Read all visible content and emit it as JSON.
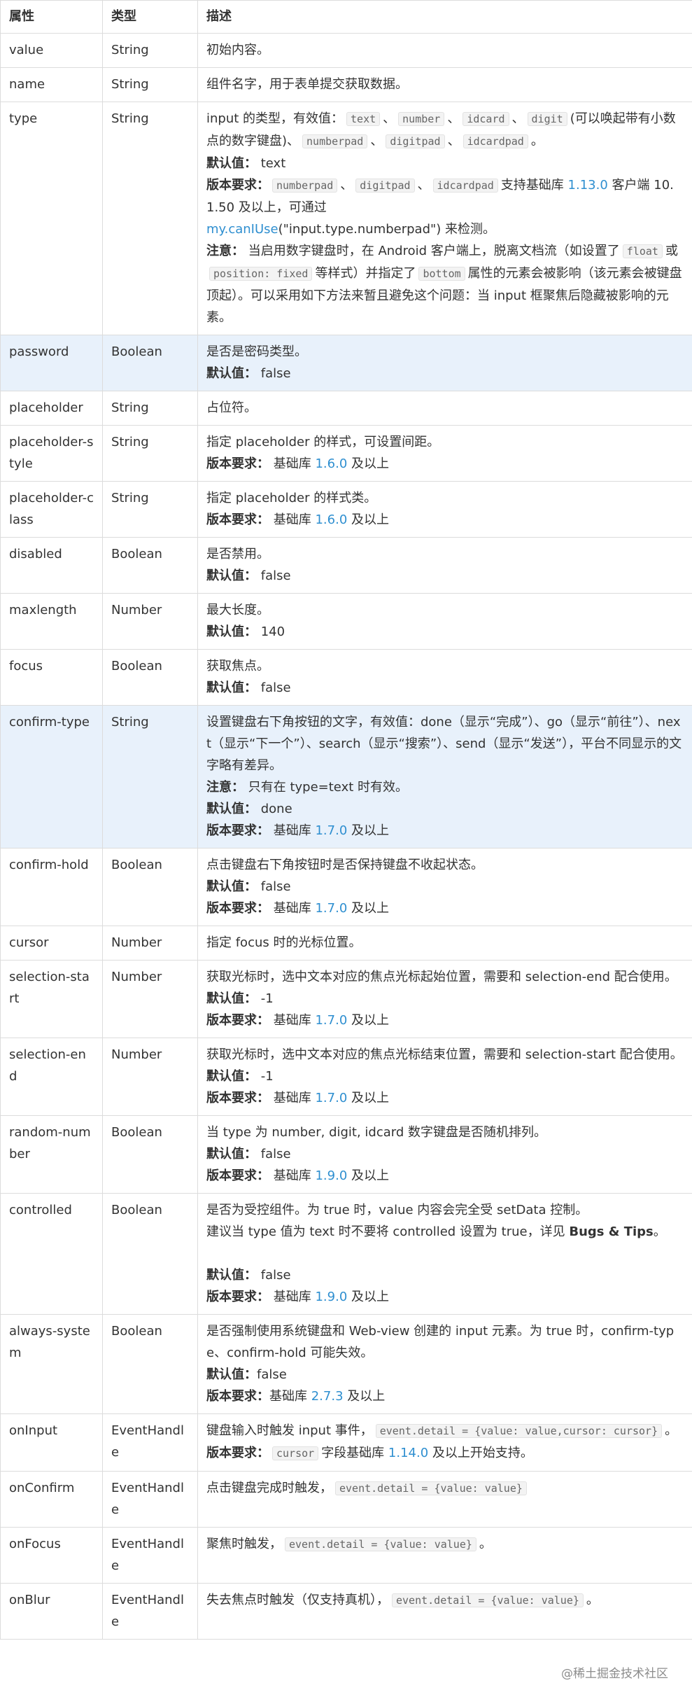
{
  "header": {
    "attr": "属性",
    "type": "类型",
    "desc": "描述"
  },
  "rows": {
    "value": {
      "name": "value",
      "type": "String",
      "desc": "初始内容。"
    },
    "name": {
      "name": "name",
      "type": "String",
      "desc": "组件名字，用于表单提交获取数据。"
    },
    "type_row": {
      "name": "type",
      "type": "String",
      "d1": "input 的类型，有效值：",
      "c_text": "text",
      "sep": "、",
      "c_number": "number",
      "c_idcard": "idcard",
      "c_digit": "digit",
      "d2": "(可以唤起带有小数点的数字键盘)、",
      "c_numberpad": "numberpad",
      "c_digitpad": "digitpad",
      "c_idcardpad": "idcardpad",
      "d3": "。",
      "default_label": "默认值：",
      "default_value": "text",
      "version_label": "版本要求：",
      "d4": "支持基础库",
      "v_lib": "1.13.0",
      "d5": "客户端 10.1.50 及以上，可通过",
      "link_canIUse": "my.canIUse",
      "d6": "(\"input.type.numberpad\") 来检测。",
      "note_label": "注意：",
      "n1": "当启用数字键盘时，在 Android 客户端上，脱离文档流（如设置了",
      "c_float": "float",
      "n2": "或",
      "c_position": "position: fixed",
      "n3": "等样式）并指定了",
      "c_bottom": "bottom",
      "n4": "属性的元素会被影响（该元素会被键盘顶起）。可以采用如下方法来暂且避免这个问题：当 input 框聚焦后隐藏被影响的元素。"
    },
    "password": {
      "name": "password",
      "type": "Boolean",
      "desc": "是否是密码类型。",
      "default_label": "默认值：",
      "default_value": "false"
    },
    "placeholder": {
      "name": "placeholder",
      "type": "String",
      "desc": "占位符。"
    },
    "placeholder_style": {
      "name": "placeholder-style",
      "type": "String",
      "desc": "指定 placeholder 的样式，可设置间距。",
      "version_label": "版本要求：",
      "v_prefix": "基础库",
      "v_num": "1.6.0",
      "v_suffix": "及以上"
    },
    "placeholder_class": {
      "name": "placeholder-class",
      "type": "String",
      "desc": "指定 placeholder 的样式类。",
      "version_label": "版本要求：",
      "v_prefix": "基础库",
      "v_num": "1.6.0",
      "v_suffix": "及以上"
    },
    "disabled": {
      "name": "disabled",
      "type": "Boolean",
      "desc": "是否禁用。",
      "default_label": "默认值：",
      "default_value": "false"
    },
    "maxlength": {
      "name": "maxlength",
      "type": "Number",
      "desc": "最大长度。",
      "default_label": "默认值：",
      "default_value": "140"
    },
    "focus": {
      "name": "focus",
      "type": "Boolean",
      "desc": "获取焦点。",
      "default_label": "默认值：",
      "default_value": "false"
    },
    "confirm_type": {
      "name": "confirm-type",
      "type": "String",
      "desc": "设置键盘右下角按钮的文字，有效值：done（显示“完成”）、go（显示“前往”）、next（显示“下一个”）、search（显示“搜索”）、send（显示“发送”），平台不同显示的文字略有差异。",
      "note_label": "注意：",
      "note": "只有在 type=text 时有效。",
      "default_label": "默认值：",
      "default_value": "done",
      "version_label": "版本要求：",
      "v_prefix": "基础库",
      "v_num": "1.7.0",
      "v_suffix": "及以上"
    },
    "confirm_hold": {
      "name": "confirm-hold",
      "type": "Boolean",
      "desc": "点击键盘右下角按钮时是否保持键盘不收起状态。",
      "default_label": "默认值：",
      "default_value": "false",
      "version_label": "版本要求：",
      "v_prefix": "基础库",
      "v_num": "1.7.0",
      "v_suffix": "及以上"
    },
    "cursor": {
      "name": "cursor",
      "type": "Number",
      "desc": "指定 focus 时的光标位置。"
    },
    "selection_start": {
      "name": "selection-start",
      "type": "Number",
      "desc": "获取光标时，选中文本对应的焦点光标起始位置，需要和 selection-end 配合使用。",
      "default_label": "默认值：",
      "default_value": "-1",
      "version_label": "版本要求：",
      "v_prefix": "基础库",
      "v_num": "1.7.0",
      "v_suffix": "及以上"
    },
    "selection_end": {
      "name": "selection-end",
      "type": "Number",
      "desc": "获取光标时，选中文本对应的焦点光标结束位置，需要和 selection-start 配合使用。",
      "default_label": "默认值：",
      "default_value": "-1",
      "version_label": "版本要求：",
      "v_prefix": "基础库",
      "v_num": "1.7.0",
      "v_suffix": "及以上"
    },
    "random_number": {
      "name": "random-number",
      "type": "Boolean",
      "desc": "当 type 为 number, digit, idcard 数字键盘是否随机排列。",
      "default_label": "默认值：",
      "default_value": "false",
      "version_label": "版本要求：",
      "v_prefix": "基础库",
      "v_num": "1.9.0",
      "v_suffix": "及以上"
    },
    "controlled": {
      "name": "controlled",
      "type": "Boolean",
      "desc": "是否为受控组件。为 true 时，value 内容会完全受 setData 控制。",
      "desc2": "建议当 type 值为 text 时不要将 controlled 设置为 true，详见",
      "bold_link": "Bugs & Tips",
      "desc2_end": "。",
      "default_label": "默认值：",
      "default_value": "false",
      "version_label": "版本要求：",
      "v_prefix": "基础库",
      "v_num": "1.9.0",
      "v_suffix": "及以上"
    },
    "always_system": {
      "name": "always-system",
      "type": "Boolean",
      "desc": "是否强制使用系统键盘和 Web-view 创建的 input 元素。为 true 时，confirm-type、confirm-hold 可能失效。",
      "default_label": "默认值：",
      "default_value": "false",
      "version_label": "版本要求：",
      "v_prefix": "基础库",
      "v_num": "2.7.3",
      "v_suffix": "及以上"
    },
    "onInput": {
      "name": "onInput",
      "type": "EventHandle",
      "desc": "键盘输入时触发 input 事件，",
      "code": "event.detail = {value: value,cursor: cursor}",
      "desc_end": "。",
      "version_label": "版本要求：",
      "c_cursor": "cursor",
      "v_mid": "字段基础库",
      "v_num": "1.14.0",
      "v_suffix": "及以上开始支持。"
    },
    "onConfirm": {
      "name": "onConfirm",
      "type": "EventHandle",
      "desc": "点击键盘完成时触发，",
      "code": "event.detail = {value: value}"
    },
    "onFocus": {
      "name": "onFocus",
      "type": "EventHandle",
      "desc": "聚焦时触发，",
      "code": "event.detail = {value: value}",
      "desc_end": "。"
    },
    "onBlur": {
      "name": "onBlur",
      "type": "EventHandle",
      "desc": "失去焦点时触发（仅支持真机），",
      "code": "event.detail = {value: value}",
      "desc_end": "。"
    }
  },
  "watermark": "@稀土掘金技术社区"
}
